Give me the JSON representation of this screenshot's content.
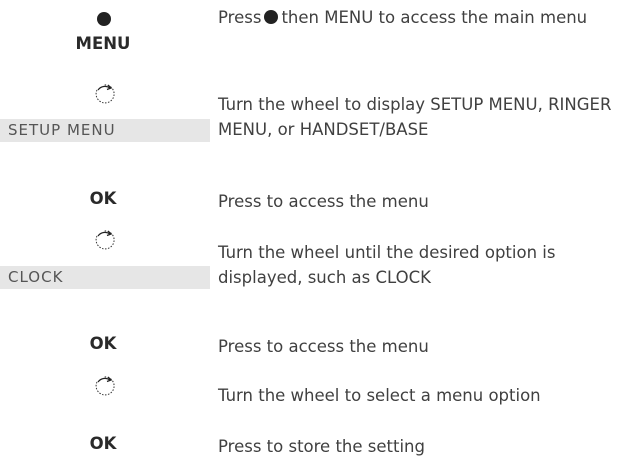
{
  "steps": [
    {
      "key": "MENU",
      "instruction_before": "Press",
      "instruction_after": "then MENU to access the main menu",
      "button_icon": "filled-circle-button"
    },
    {
      "display": "SETUP MENU",
      "instruction": "Turn the wheel to display SETUP MENU, RINGER MENU, or HANDSET/BASE",
      "icon": "wheel-turn-icon"
    },
    {
      "key": "OK",
      "instruction": "Press to access the menu"
    },
    {
      "display": "CLOCK",
      "instruction": "Turn the wheel until the desired option is displayed, such as CLOCK",
      "icon": "wheel-turn-icon"
    },
    {
      "key": "OK",
      "instruction": "Press to access the menu"
    },
    {
      "instruction": "Turn the wheel to select a menu option",
      "icon": "wheel-turn-icon"
    },
    {
      "key": "OK",
      "instruction": "Press to store the setting"
    }
  ]
}
